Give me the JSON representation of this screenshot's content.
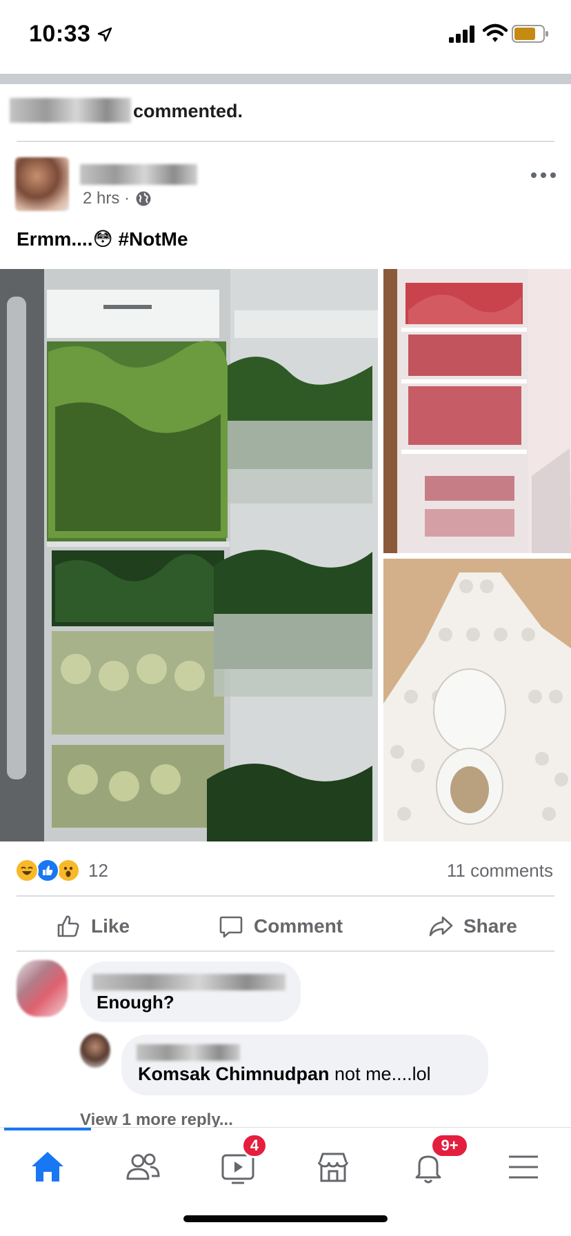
{
  "status_bar": {
    "time": "10:33",
    "icons": [
      "location-arrow-icon",
      "cellular-signal-icon",
      "wifi-icon",
      "battery-icon"
    ],
    "battery_color": "#c58a12"
  },
  "notice": {
    "text": "commented."
  },
  "post": {
    "timestamp": "2 hrs ·",
    "privacy_icon": "globe-icon",
    "text": "Ermm....😳 #NotMe",
    "photos": [
      "fridge-vegetables-photo",
      "fridge-meat-photo",
      "toilet-paper-photo"
    ]
  },
  "reactions": {
    "types": [
      "haha",
      "like",
      "wow"
    ],
    "count": "12",
    "comments_label": "11 comments"
  },
  "actions": {
    "like": "Like",
    "comment": "Comment",
    "share": "Share"
  },
  "comments": [
    {
      "text": "Enough?"
    },
    {
      "mention": "Komsak Chimnudpan",
      "text": " not me....lol"
    }
  ],
  "view_more_replies": "View 1 more reply...",
  "tab_bar": {
    "tabs": [
      "home-icon",
      "friends-icon",
      "watch-icon",
      "marketplace-icon",
      "notifications-icon",
      "menu-icon"
    ],
    "watch_badge": "4",
    "notifications_badge": "9+",
    "active_color": "#1877f2"
  }
}
